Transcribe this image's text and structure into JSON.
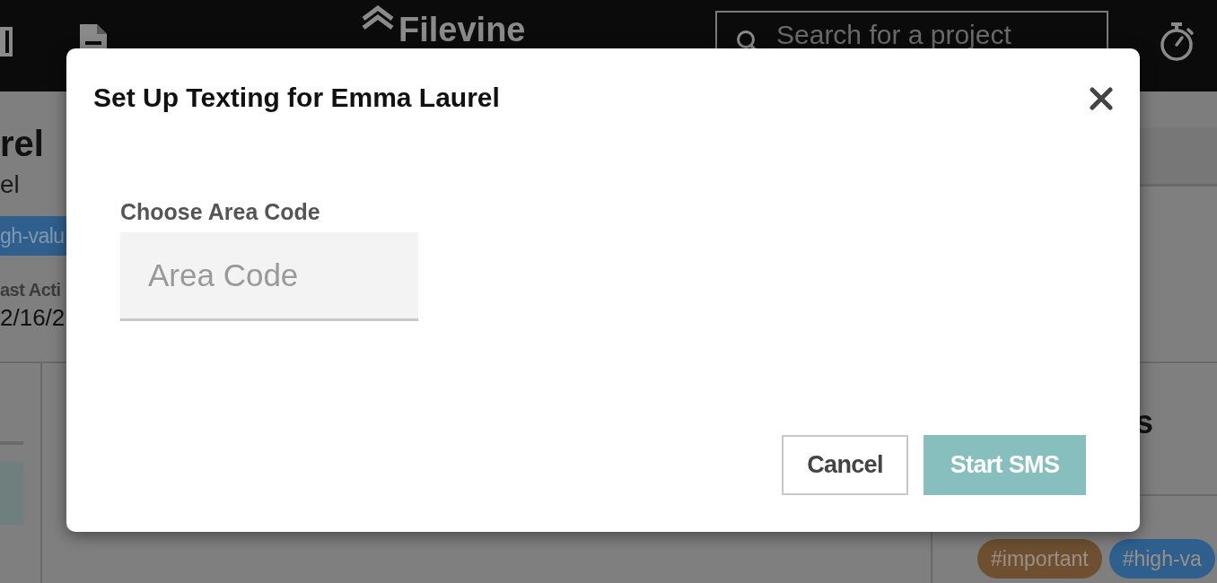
{
  "top_bar": {
    "logo": {
      "text": "Filevine"
    },
    "search": {
      "placeholder": "Search for a project"
    }
  },
  "page": {
    "header": {
      "title": "rel",
      "subtitle": "el",
      "tags": [
        {
          "label": "gh-valu",
          "color": "#2e5f8d"
        }
      ],
      "field": {
        "label": "ast Acti",
        "value": "2/16/2"
      }
    },
    "side_panel": {
      "heading": "s",
      "tags": [
        {
          "label": "#important",
          "color": "#6e5030"
        },
        {
          "label": "#high-va",
          "color": "#2e5f8d"
        }
      ]
    }
  },
  "dialog": {
    "title": "Set Up Texting for Emma Laurel",
    "field": {
      "label": "Choose Area Code",
      "placeholder": "Area Code"
    },
    "buttons": [
      {
        "label": "Cancel",
        "kind": "secondary"
      },
      {
        "label": "Start SMS",
        "kind": "primary"
      }
    ]
  }
}
